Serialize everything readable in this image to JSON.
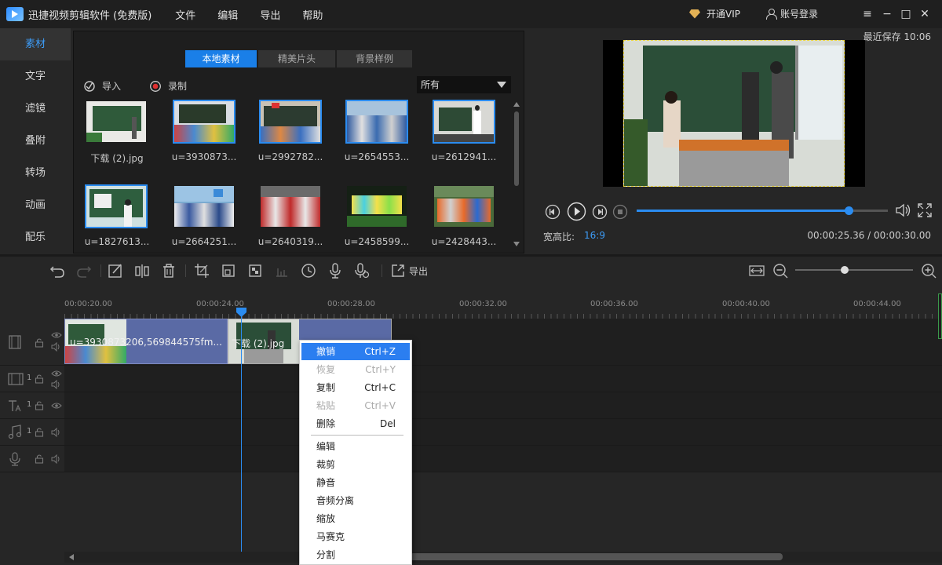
{
  "app": {
    "title": "迅捷视频剪辑软件 (免费版)",
    "menus": [
      "文件",
      "编辑",
      "导出",
      "帮助"
    ]
  },
  "account": {
    "vip_label": "开通VIP",
    "login_label": "账号登录"
  },
  "window_controls": {
    "menu": "≡",
    "minimize": "−",
    "maximize": "□",
    "close": "✕"
  },
  "sidebar": {
    "items": [
      "素材",
      "文字",
      "滤镜",
      "叠附",
      "转场",
      "动画",
      "配乐"
    ],
    "active": 0
  },
  "media": {
    "tabs": [
      "本地素材",
      "精美片头",
      "背景样例"
    ],
    "import_label": "导入",
    "record_label": "录制",
    "filter_value": "所有",
    "items": [
      {
        "name": "下载 (2).jpg"
      },
      {
        "name": "u=3930873..."
      },
      {
        "name": "u=2992782..."
      },
      {
        "name": "u=2654553..."
      },
      {
        "name": "u=2612941..."
      },
      {
        "name": "u=1827613..."
      },
      {
        "name": "u=2664251..."
      },
      {
        "name": "u=2640319..."
      },
      {
        "name": "u=2458599..."
      },
      {
        "name": "u=2428443..."
      }
    ]
  },
  "preview": {
    "last_saved": "最近保存 10:06",
    "aspect_label": "宽高比:",
    "aspect_value": "16:9",
    "time": "00:00:25.36 / 00:00:30.00",
    "progress": 0.845
  },
  "toolbar": {
    "export_label": "导出",
    "zoom_level": 0.42
  },
  "ruler": {
    "ticks": [
      "00:00:20.00",
      "00:00:24.00",
      "00:00:28.00",
      "00:00:32.00",
      "00:00:36.00",
      "00:00:40.00",
      "00:00:44.00"
    ]
  },
  "tracks": {
    "video_clips": [
      {
        "label": "u=3930873206,569844575fm..."
      },
      {
        "label": "下载 (2).jpg"
      }
    ],
    "track_numbers": [
      "1",
      "1",
      "1"
    ]
  },
  "context_menu": {
    "items": [
      {
        "label": "撤销",
        "shortcut": "Ctrl+Z",
        "state": "highlighted"
      },
      {
        "label": "恢复",
        "shortcut": "Ctrl+Y",
        "state": "disabled"
      },
      {
        "label": "复制",
        "shortcut": "Ctrl+C",
        "state": "normal"
      },
      {
        "label": "粘贴",
        "shortcut": "Ctrl+V",
        "state": "disabled"
      },
      {
        "label": "删除",
        "shortcut": "Del",
        "state": "normal"
      },
      {
        "label": "编辑",
        "shortcut": "",
        "state": "normal"
      },
      {
        "label": "裁剪",
        "shortcut": "",
        "state": "normal"
      },
      {
        "label": "静音",
        "shortcut": "",
        "state": "normal"
      },
      {
        "label": "音频分离",
        "shortcut": "",
        "state": "normal"
      },
      {
        "label": "缩放",
        "shortcut": "",
        "state": "normal"
      },
      {
        "label": "马赛克",
        "shortcut": "",
        "state": "normal"
      },
      {
        "label": "分割",
        "shortcut": "",
        "state": "normal"
      }
    ]
  },
  "colors": {
    "accent": "#1a7fe8",
    "clip": "#5a6aa5",
    "playhead": "#2b8cf0"
  }
}
